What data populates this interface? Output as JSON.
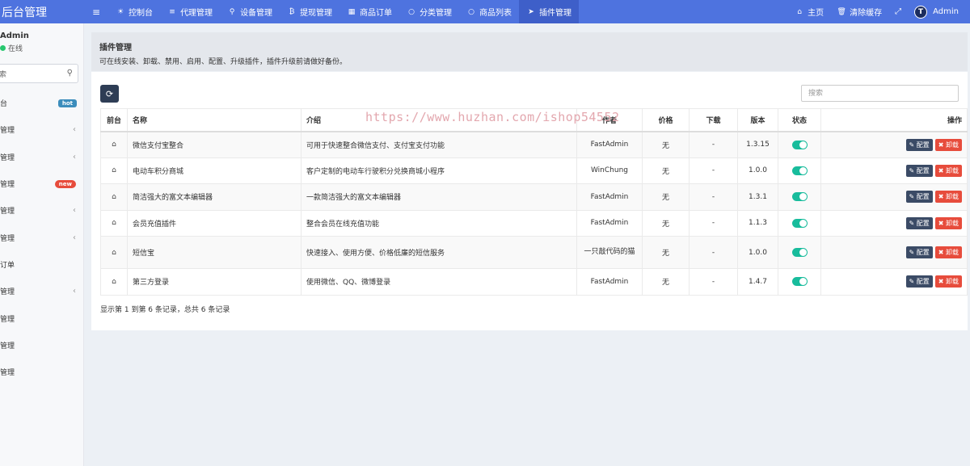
{
  "brand": "后台管理",
  "nav": {
    "toggle": "≡",
    "items": [
      {
        "icon": "☀",
        "label": "控制台"
      },
      {
        "icon": "≡",
        "label": "代理管理"
      },
      {
        "icon": "⚲",
        "label": "设备管理"
      },
      {
        "icon": "₿",
        "label": "提现管理"
      },
      {
        "icon": "▦",
        "label": "商品订单"
      },
      {
        "icon": "○",
        "label": "分类管理"
      },
      {
        "icon": "○",
        "label": "商品列表"
      },
      {
        "icon": "➤",
        "label": "插件管理"
      }
    ],
    "right": {
      "home": "主页",
      "clear_cache": "清除缓存",
      "fullscreen": "⤢",
      "avatar_letter": "T",
      "admin": "Admin"
    }
  },
  "sidebar": {
    "user_name": "Admin",
    "status": "在线",
    "search_placeholder": "索",
    "items": [
      {
        "label": "台",
        "badge": "hot"
      },
      {
        "label": "管理",
        "arrow": "‹"
      },
      {
        "label": "管理",
        "arrow": "‹"
      },
      {
        "label": "管理",
        "badge": "new"
      },
      {
        "label": "管理",
        "arrow": "‹"
      },
      {
        "label": "管理",
        "arrow": "‹"
      },
      {
        "label": "订单"
      },
      {
        "label": "管理",
        "arrow": "‹"
      },
      {
        "label": "管理"
      },
      {
        "label": "管理"
      },
      {
        "label": "管理"
      }
    ]
  },
  "header": {
    "title": "插件管理",
    "description": "可在线安装、卸载、禁用、启用、配置、升级插件，插件升级前请做好备份。"
  },
  "toolbar": {
    "search_placeholder": "搜索"
  },
  "table": {
    "columns": [
      "前台",
      "名称",
      "介绍",
      "作者",
      "价格",
      "下载",
      "版本",
      "状态",
      "操作"
    ],
    "config_label": "配置",
    "uninstall_label": "卸载",
    "rows": [
      {
        "name": "微信支付宝整合",
        "intro": "可用于快速整合微信支付、支付宝支付功能",
        "author": "FastAdmin",
        "price": "无",
        "downloads": "-",
        "version": "1.3.15",
        "enabled": true
      },
      {
        "name": "电动车积分商城",
        "intro": "客户定制的电动车行驶积分兑换商城小程序",
        "author": "WinChung",
        "price": "无",
        "downloads": "-",
        "version": "1.0.0",
        "enabled": true
      },
      {
        "name": "简洁强大的富文本编辑器",
        "intro": "一款简洁强大的富文本编辑器",
        "author": "FastAdmin",
        "price": "无",
        "downloads": "-",
        "version": "1.3.1",
        "enabled": true
      },
      {
        "name": "会员充值插件",
        "intro": "整合会员在线充值功能",
        "author": "FastAdmin",
        "price": "无",
        "downloads": "-",
        "version": "1.1.3",
        "enabled": true
      },
      {
        "name": "短信宝",
        "intro": "快速接入、使用方便、价格低廉的短信服务",
        "author": "一只敲代码的猫",
        "price": "无",
        "downloads": "-",
        "version": "1.0.0",
        "enabled": true
      },
      {
        "name": "第三方登录",
        "intro": "使用微信、QQ、微博登录",
        "author": "FastAdmin",
        "price": "无",
        "downloads": "-",
        "version": "1.4.7",
        "enabled": true
      }
    ]
  },
  "pager": {
    "info": "显示第 1 到第 6 条记录，总共 6 条记录"
  },
  "watermark": "https://www.huzhan.com/ishop54552",
  "colors": {
    "topbar": "#4e73df",
    "toggle_on": "#18bc9c",
    "danger": "#e74c3c",
    "dark_button": "#3b4b66"
  }
}
